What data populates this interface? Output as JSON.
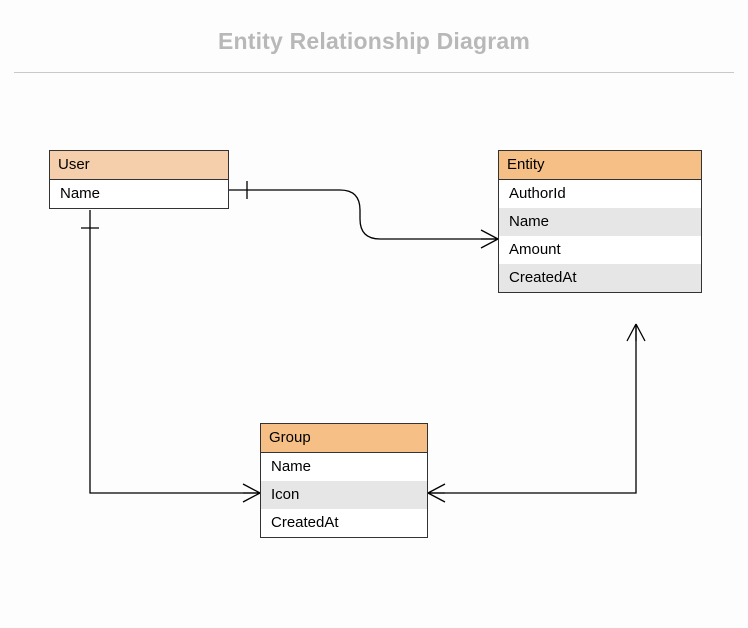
{
  "title": "Entity Relationship Diagram",
  "tables": {
    "user": {
      "name": "User",
      "fields": [
        "Name"
      ]
    },
    "entity": {
      "name": "Entity",
      "fields": [
        "AuthorId",
        "Name",
        "Amount",
        "CreatedAt"
      ]
    },
    "group": {
      "name": "Group",
      "fields": [
        "Name",
        "Icon",
        "CreatedAt"
      ]
    }
  },
  "relationships": [
    {
      "from": "User",
      "to": "Entity",
      "cardinality": "one-to-many"
    },
    {
      "from": "User",
      "to": "Group",
      "cardinality": "one-to-many"
    },
    {
      "from": "Entity",
      "to": "Group",
      "cardinality": "many-to-many"
    }
  ],
  "chart_data": {
    "type": "table",
    "description": "Entity-Relationship diagram with three entities and three relationships",
    "entities": [
      {
        "name": "User",
        "attributes": [
          "Name"
        ]
      },
      {
        "name": "Entity",
        "attributes": [
          "AuthorId",
          "Name",
          "Amount",
          "CreatedAt"
        ]
      },
      {
        "name": "Group",
        "attributes": [
          "Name",
          "Icon",
          "CreatedAt"
        ]
      }
    ],
    "relationships": [
      {
        "from": "User",
        "to": "Entity",
        "type": "one-to-many"
      },
      {
        "from": "User",
        "to": "Group",
        "type": "one-to-many"
      },
      {
        "from": "Entity",
        "to": "Group",
        "type": "many-to-many"
      }
    ]
  }
}
